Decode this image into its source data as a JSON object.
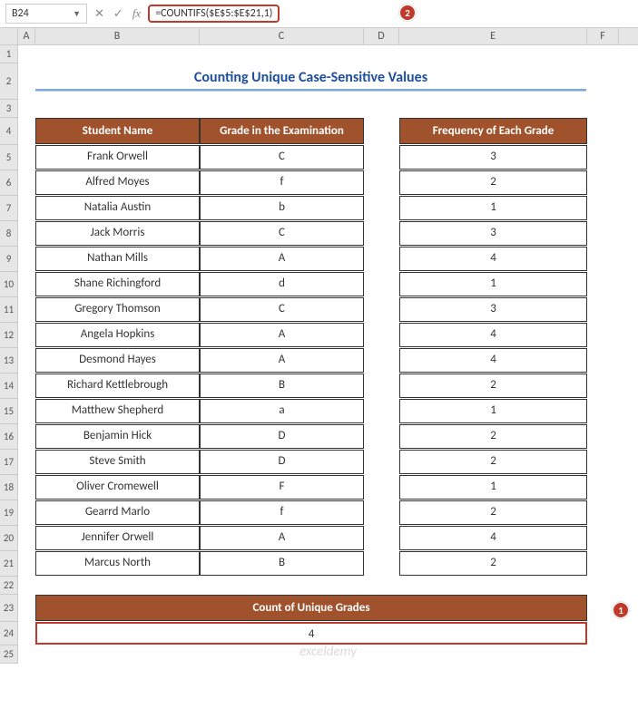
{
  "formula_bar": {
    "cell_ref": "B24",
    "formula": "=COUNTIFS($E$5:$E$21,1)"
  },
  "columns": {
    "A": "A",
    "B": "B",
    "C": "C",
    "D": "D",
    "E": "E",
    "F": "F"
  },
  "title": "Counting Unique Case-Sensitive Values",
  "headers": {
    "student": "Student Name",
    "grade": "Grade in the Examination",
    "freq": "Frequency of Each Grade"
  },
  "rows": [
    {
      "n": "5",
      "name": "Frank Orwell",
      "grade": "C",
      "freq": "3"
    },
    {
      "n": "6",
      "name": "Alfred Moyes",
      "grade": "f",
      "freq": "2"
    },
    {
      "n": "7",
      "name": "Natalia Austin",
      "grade": "b",
      "freq": "1"
    },
    {
      "n": "8",
      "name": "Jack Morris",
      "grade": "C",
      "freq": "3"
    },
    {
      "n": "9",
      "name": "Nathan Mills",
      "grade": "A",
      "freq": "4"
    },
    {
      "n": "10",
      "name": "Shane Richingford",
      "grade": "d",
      "freq": "1"
    },
    {
      "n": "11",
      "name": "Gregory Thomson",
      "grade": "C",
      "freq": "3"
    },
    {
      "n": "12",
      "name": "Angela Hopkins",
      "grade": "A",
      "freq": "4"
    },
    {
      "n": "13",
      "name": "Desmond Hayes",
      "grade": "A",
      "freq": "4"
    },
    {
      "n": "14",
      "name": "Richard Kettlebrough",
      "grade": "B",
      "freq": "2"
    },
    {
      "n": "15",
      "name": "Matthew Shepherd",
      "grade": "a",
      "freq": "1"
    },
    {
      "n": "16",
      "name": "Benjamin Hick",
      "grade": "D",
      "freq": "2"
    },
    {
      "n": "17",
      "name": "Steve Smith",
      "grade": "D",
      "freq": "2"
    },
    {
      "n": "18",
      "name": "Oliver Cromewell",
      "grade": "F",
      "freq": "1"
    },
    {
      "n": "19",
      "name": "Gearrd Marlo",
      "grade": "f",
      "freq": "2"
    },
    {
      "n": "20",
      "name": "Jennifer Orwell",
      "grade": "A",
      "freq": "4"
    },
    {
      "n": "21",
      "name": "Marcus North",
      "grade": "B",
      "freq": "2"
    }
  ],
  "count_header": "Count of Unique Grades",
  "count_value": "4",
  "callouts": {
    "one": "1",
    "two": "2"
  },
  "watermark": "exceldemy",
  "row_nums": {
    "r1": "1",
    "r2": "2",
    "r3": "3",
    "r4": "4",
    "r22": "22",
    "r23": "23",
    "r24": "24",
    "r25": "25"
  }
}
